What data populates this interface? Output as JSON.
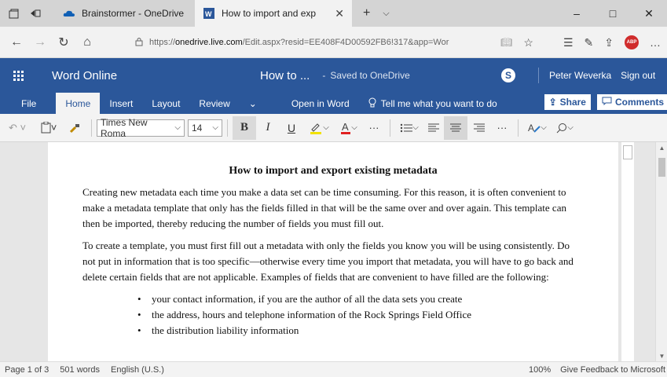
{
  "browser": {
    "tabs": [
      {
        "title": "Brainstormer - OneDrive",
        "icon": "onedrive-cloud-icon"
      },
      {
        "title": "How to import and exp",
        "icon": "word-doc-icon"
      }
    ],
    "url_prefix": "https://",
    "url_host": "onedrive.live.com",
    "url_path": "/Edit.aspx?resid=EE408F4D00592FB6!317&app=Wor",
    "window_controls": {
      "minimize": "–",
      "maximize": "□",
      "close": "✕"
    },
    "abp_label": "ABP"
  },
  "word": {
    "app_name": "Word Online",
    "doc_name": "How to ...",
    "dash": "-",
    "save_status": "Saved to OneDrive",
    "user_name": "Peter Weverka",
    "sign_out": "Sign out",
    "skype_letter": "S",
    "accent": "#2b579a"
  },
  "ribbon": {
    "tabs": [
      "File",
      "Home",
      "Insert",
      "Layout",
      "Review"
    ],
    "more": "⌄",
    "open_in_word": "Open in Word",
    "tell_me": "Tell me what you want to do",
    "share": "Share",
    "comments": "Comments"
  },
  "toolbar": {
    "font_name": "Times New Roma",
    "font_size": "14",
    "bold": "B",
    "italic": "I",
    "underline": "U",
    "more": "···"
  },
  "document": {
    "title": "How to import and export existing metadata",
    "paragraphs": [
      "Creating new metadata each time you make a data set can be time consuming. For this reason, it is often convenient to make a metadata template that only has the fields filled in that will be the same over and over again. This template can then be imported, thereby reducing the number of fields you must fill out.",
      "To create a template, you must first fill out a metadata with only the fields you know you will be using consistently. Do not put in information that is too specific—otherwise every time you import that metadata, you will have to go back and delete certain fields that are not applicable. Examples of fields that are convenient to have filled are the following:"
    ],
    "bullets": [
      "your contact information, if you are the author of all the data sets you create",
      "the address, hours and telephone information of the Rock Springs Field Office",
      "the distribution liability information"
    ]
  },
  "status": {
    "page": "Page 1 of 3",
    "words": "501 words",
    "language": "English (U.S.)",
    "zoom": "100%",
    "feedback": "Give Feedback to Microsoft"
  }
}
